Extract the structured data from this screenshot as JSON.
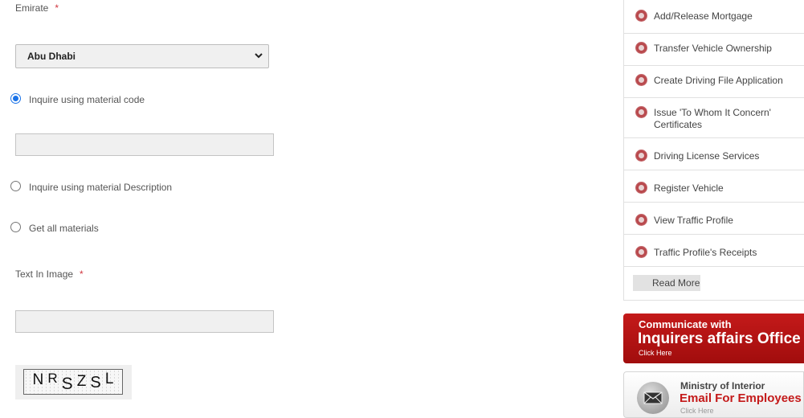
{
  "form": {
    "emirate_label": "Emirate",
    "required_mark": "*",
    "emirate_selected": "Abu Dhabi",
    "radio_options": [
      {
        "label": "Inquire using material code",
        "checked": true
      },
      {
        "label": "Inquire using material Description",
        "checked": false
      },
      {
        "label": "Get all materials",
        "checked": false
      }
    ],
    "material_code_value": "",
    "text_in_image_label": "Text In Image",
    "text_in_image_value": "",
    "captcha_chars": [
      "N",
      "R",
      "S",
      "Z",
      "S",
      "L"
    ]
  },
  "sidebar": {
    "items": [
      {
        "label": "Add/Release Mortgage"
      },
      {
        "label": "Transfer Vehicle Ownership"
      },
      {
        "label": "Create Driving File Application"
      },
      {
        "label": "Issue 'To Whom It Concern' Certificates"
      },
      {
        "label": "Driving License Services"
      },
      {
        "label": "Register Vehicle"
      },
      {
        "label": "View Traffic Profile"
      },
      {
        "label": "Traffic Profile's Receipts"
      }
    ],
    "read_more": "Read More"
  },
  "banners": {
    "inquirers": {
      "line1": "Communicate with",
      "line2": "Inquirers affairs Office",
      "line3": "Click Here"
    },
    "email": {
      "line1": "Ministry of Interior",
      "line2": "Email For Employees",
      "line3": "Click Here"
    }
  },
  "colors": {
    "accent_red": "#c41a1a",
    "radio_blue": "#1a73e8",
    "required_red": "#d0363f"
  }
}
